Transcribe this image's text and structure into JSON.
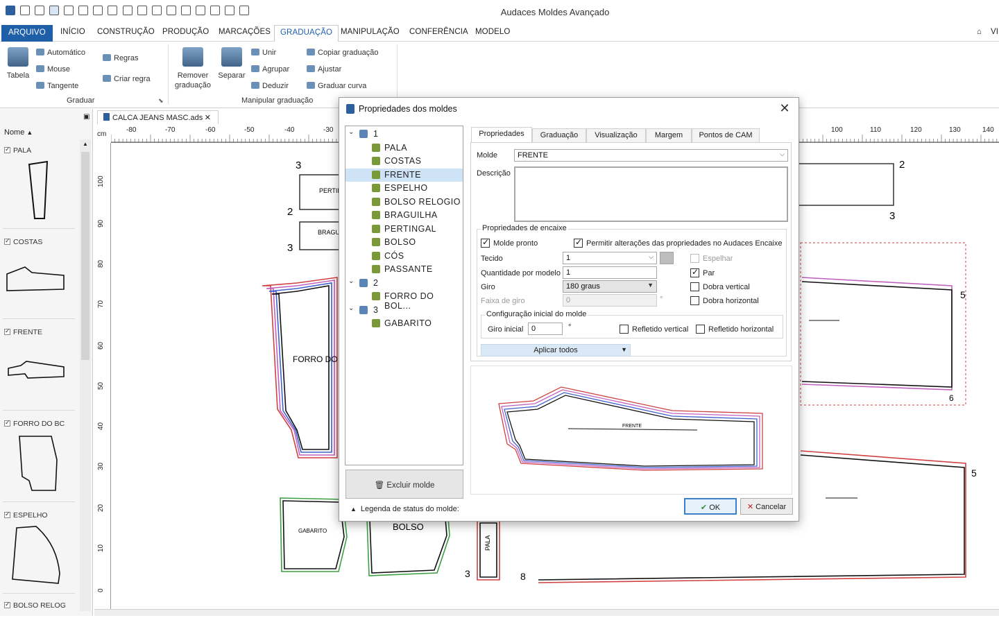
{
  "app": {
    "title": "Audaces Moldes Avançado"
  },
  "menu": {
    "file": "ARQUIVO",
    "tabs": [
      "INÍCIO",
      "CONSTRUÇÃO",
      "PRODUÇÃO",
      "MARCAÇÕES",
      "GRADUAÇÃO",
      "MANIPULAÇÃO",
      "CONFERÊNCIA",
      "MODELO"
    ],
    "active": "GRADUAÇÃO",
    "right_label": "VI"
  },
  "ribbon": {
    "tabela": "Tabela",
    "automatico": "Automático",
    "mouse": "Mouse",
    "tangente": "Tangente",
    "regras": "Regras",
    "criar_regra": "Criar regra",
    "remover_graduacao": [
      "Remover",
      "graduação"
    ],
    "separar": "Separar",
    "unir": "Unir",
    "agrupar": "Agrupar",
    "deduzir": "Deduzir",
    "copiar_graduacao": "Copiar graduação",
    "ajustar": "Ajustar",
    "graduar_curva": "Graduar curva",
    "group_graduar": "Graduar",
    "group_manipular": "Manipular graduação"
  },
  "left_panel": {
    "sort_label": "Nome",
    "items": [
      "PALA",
      "COSTAS",
      "FRENTE",
      "FORRO DO BC",
      "ESPELHO",
      "BOLSO RELOG"
    ]
  },
  "document": {
    "tab": "CALCA JEANS MASC.ads",
    "units": "cm"
  },
  "ruler": {
    "top_left": [
      "-80",
      "-70",
      "-60",
      "-50",
      "-40",
      "-30"
    ],
    "top_right": [
      "100",
      "110",
      "120",
      "130",
      "140"
    ],
    "left": [
      "100",
      "90",
      "80",
      "70",
      "60",
      "50",
      "40",
      "30",
      "20",
      "10",
      "0"
    ]
  },
  "canvas_labels": {
    "forro": "FORRO DO",
    "gabarito": "GABARITO",
    "bolso": "BOLSO",
    "pala": "PALA",
    "pertin": "PERTIN",
    "bragu": "BRAGU",
    "marks": [
      "3",
      "2",
      "3",
      "2",
      "3",
      "5",
      "6",
      "5",
      "3",
      "8"
    ]
  },
  "dialog": {
    "title": "Propriedades dos moldes",
    "tree": [
      {
        "level": 0,
        "label": "1",
        "type": "group"
      },
      {
        "level": 1,
        "label": "PALA"
      },
      {
        "level": 1,
        "label": "COSTAS"
      },
      {
        "level": 1,
        "label": "FRENTE",
        "selected": true
      },
      {
        "level": 1,
        "label": "ESPELHO"
      },
      {
        "level": 1,
        "label": "BOLSO RELOGIO"
      },
      {
        "level": 1,
        "label": "BRAGUILHA"
      },
      {
        "level": 1,
        "label": "PERTINGAL"
      },
      {
        "level": 1,
        "label": "BOLSO"
      },
      {
        "level": 1,
        "label": "CÓS"
      },
      {
        "level": 1,
        "label": "PASSANTE"
      },
      {
        "level": 0,
        "label": "2",
        "type": "group"
      },
      {
        "level": 1,
        "label": "FORRO DO BOL..."
      },
      {
        "level": 0,
        "label": "3",
        "type": "group"
      },
      {
        "level": 1,
        "label": "GABARITO"
      }
    ],
    "excluir": "Excluir molde",
    "legenda": "Legenda de status do molde:",
    "tabs": [
      "Propriedades",
      "Graduação",
      "Visualização",
      "Margem",
      "Pontos de CAM"
    ],
    "active_tab": "Propriedades",
    "molde_label": "Molde",
    "molde_value": "FRENTE",
    "descricao_label": "Descrição",
    "encaixe_title": "Propriedades de encaixe",
    "molde_pronto": "Molde pronto",
    "permitir": "Permitir alterações das propriedades no Audaces Encaixe",
    "tecido_label": "Tecido",
    "tecido_value": "1",
    "espelhar": "Espelhar",
    "quantidade_label": "Quantidade por modelo",
    "quantidade_value": "1",
    "par": "Par",
    "giro_label": "Giro",
    "giro_value": "180 graus",
    "dobra_vertical": "Dobra vertical",
    "faixa_label": "Faixa de giro",
    "faixa_value": "0",
    "dobra_horizontal": "Dobra horizontal",
    "config_title": "Configuração inicial do molde",
    "giro_inicial_label": "Giro inicial",
    "giro_inicial_value": "0",
    "refletido_vertical": "Refletido vertical",
    "refletido_horizontal": "Refletido horizontal",
    "aplicar": "Aplicar todos",
    "degree": "°",
    "preview_label": "FRENTE",
    "ok": "OK",
    "cancelar": "Cancelar"
  },
  "colors": {
    "accent": "#1f5fa8",
    "selection": "#cfe3f7"
  }
}
